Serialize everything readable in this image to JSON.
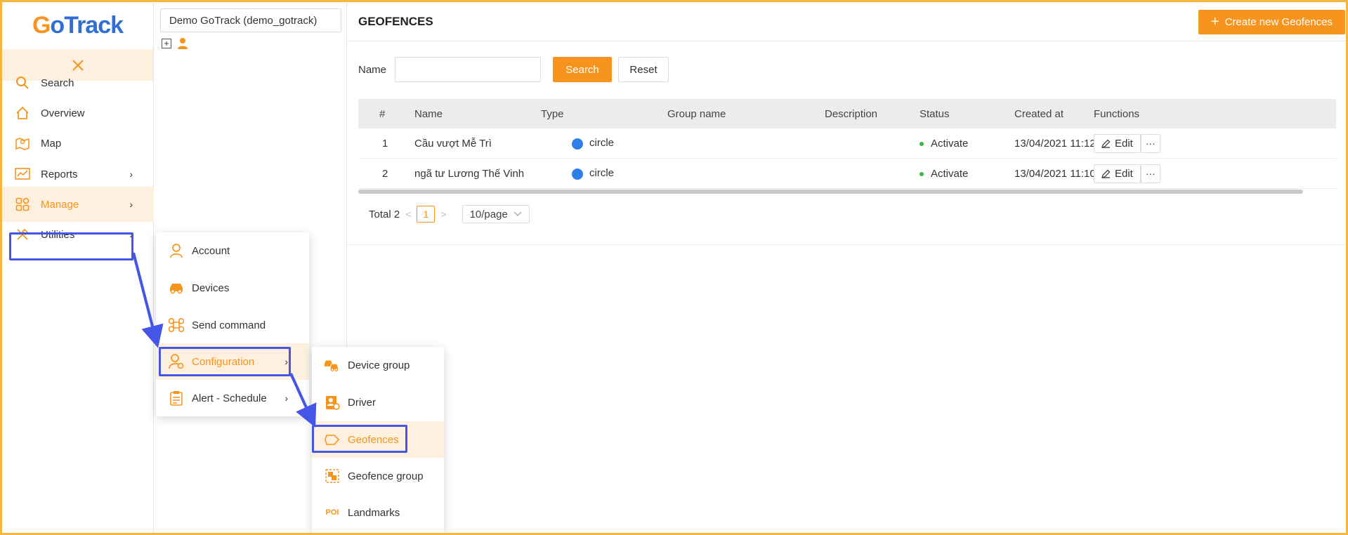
{
  "brand": {
    "logo_g": "G",
    "logo_rest_o": "o",
    "logo_track": "Track"
  },
  "sidebar": {
    "collapse_icon": "close-icon",
    "items": [
      {
        "label": "Search",
        "icon": "search-icon"
      },
      {
        "label": "Overview",
        "icon": "home-icon"
      },
      {
        "label": "Map",
        "icon": "map-icon"
      },
      {
        "label": "Reports",
        "icon": "chart-icon",
        "chevron": "›"
      },
      {
        "label": "Manage",
        "icon": "grid-icon",
        "chevron": "›"
      },
      {
        "label": "Utilities",
        "icon": "tools-icon",
        "chevron": "›"
      }
    ]
  },
  "tree": {
    "org_name": "Demo GoTrack (demo_gotrack)",
    "expand_symbol": "+"
  },
  "manage_menu": {
    "items": [
      {
        "label": "Account",
        "icon": "user-icon"
      },
      {
        "label": "Devices",
        "icon": "car-icon"
      },
      {
        "label": "Send command",
        "icon": "command-icon"
      },
      {
        "label": "Configuration",
        "icon": "user-settings-icon",
        "chevron": "›"
      },
      {
        "label": "Alert - Schedule",
        "icon": "clipboard-icon",
        "chevron": "›"
      }
    ]
  },
  "config_menu": {
    "items": [
      {
        "label": "Device group",
        "icon": "cars-icon"
      },
      {
        "label": "Driver",
        "icon": "driver-icon"
      },
      {
        "label": "Geofences",
        "icon": "geofence-icon"
      },
      {
        "label": "Geofence group",
        "icon": "geofence-group-icon"
      },
      {
        "label": "Landmarks",
        "icon": "poi-icon",
        "icon_text": "POI"
      }
    ]
  },
  "main": {
    "title": "GEOFENCES",
    "create_button": "Create new Geofences",
    "create_symbol": "+",
    "filter": {
      "name_label": "Name",
      "name_value": "",
      "search_button": "Search",
      "reset_button": "Reset"
    },
    "table": {
      "columns": [
        "#",
        "Name",
        "Type",
        "Group name",
        "Description",
        "Status",
        "Created at",
        "Functions"
      ],
      "rows": [
        {
          "num": "1",
          "name": "Cầu vượt Mễ Trì",
          "type": "circle",
          "group": "",
          "description": "",
          "status": "Activate",
          "created_at": "13/04/2021 11:12",
          "edit": "Edit",
          "more": "···"
        },
        {
          "num": "2",
          "name": "ngã tư Lương Thế Vinh",
          "type": "circle",
          "group": "",
          "description": "",
          "status": "Activate",
          "created_at": "13/04/2021 11:10",
          "edit": "Edit",
          "more": "···"
        }
      ]
    },
    "pagination": {
      "total": "Total 2",
      "prev": "<",
      "page": "1",
      "next": ">",
      "page_size": "10/page"
    }
  },
  "colors": {
    "accent": "#f7941d",
    "accent_light": "#fdf0df",
    "brand_blue": "#2f6fd6",
    "highlight": "#4455e8",
    "status_green": "#3bb54a"
  }
}
